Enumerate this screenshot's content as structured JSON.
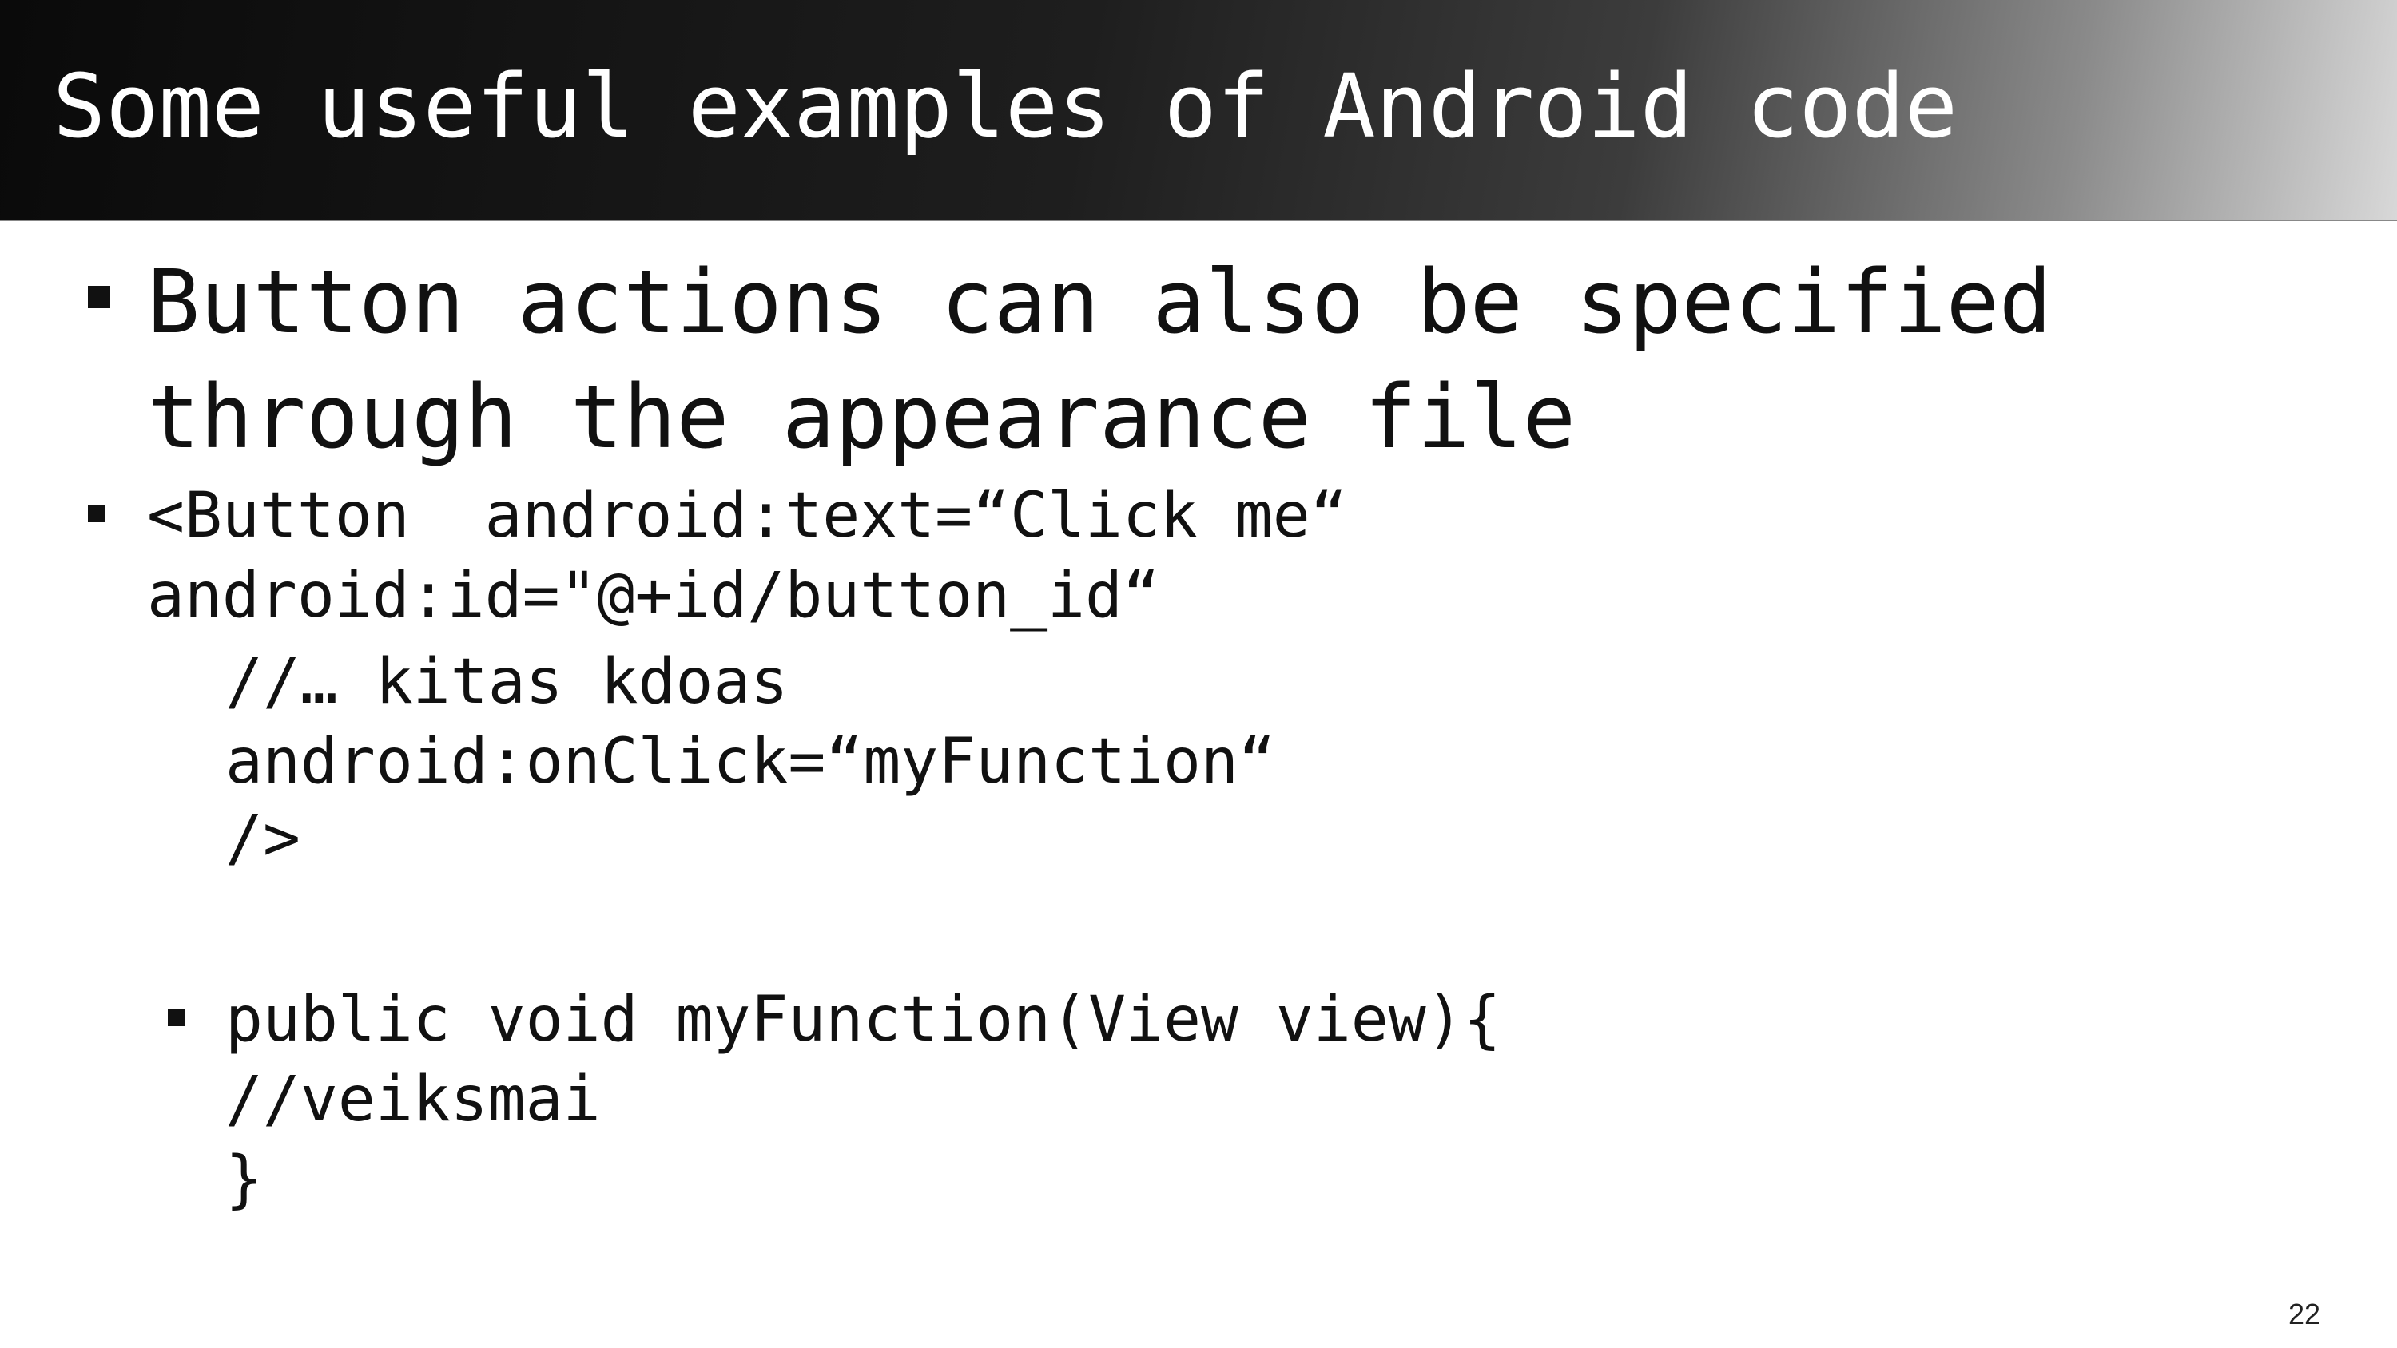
{
  "slide": {
    "title": "Some useful examples of Android code",
    "bullets": [
      {
        "lines": [
          "Button actions can also be specified",
          "through the appearance file"
        ]
      },
      {
        "lines": [
          "<Button  android:text=“Click me“",
          "android:id=\"@+id/button_id“"
        ],
        "continuation": [
          "//… kitas kdoas",
          "android:onClick=“myFunction“",
          "/>"
        ]
      },
      {
        "lines": [
          "public void myFunction(View view){",
          "//veiksmai",
          "}"
        ]
      }
    ],
    "page_number": "22"
  },
  "colors": {
    "title_text": "#ffffff",
    "title_bar_dark": "#0a0a0a",
    "title_bar_light": "#d8d8d8",
    "body_text": "#111111",
    "background": "#ffffff"
  }
}
